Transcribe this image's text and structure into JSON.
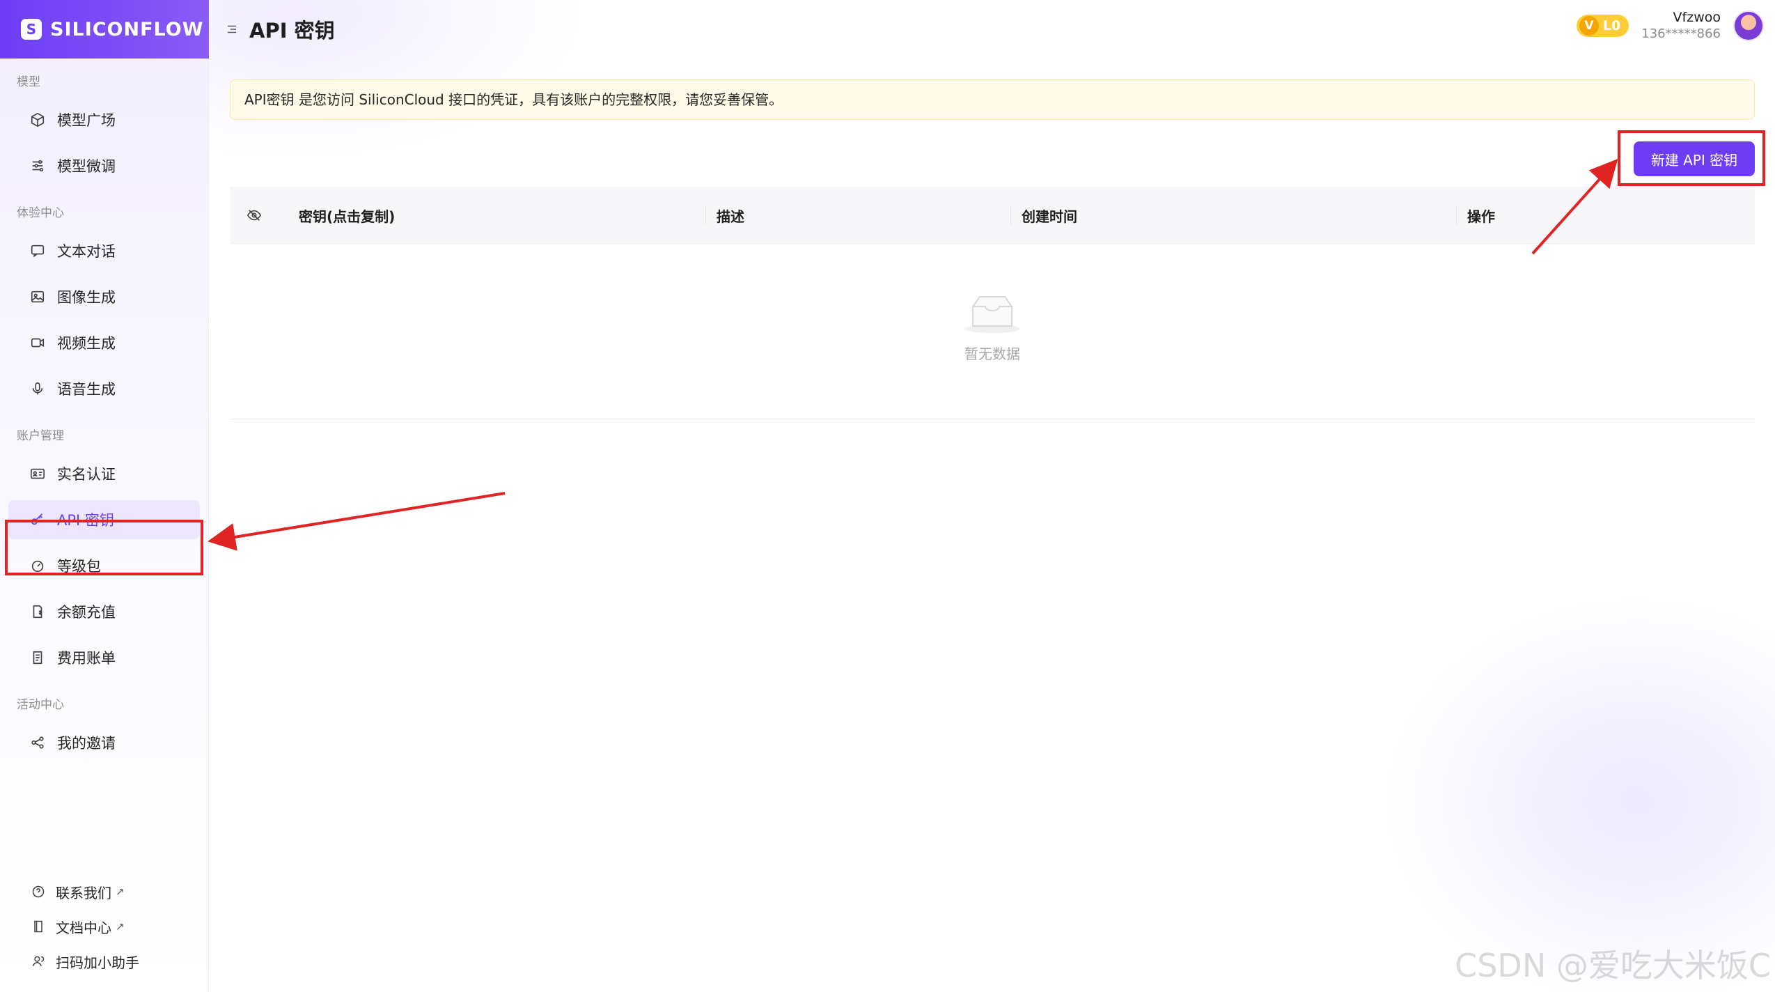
{
  "brand": {
    "name": "SILICONFLOW"
  },
  "sidebar": {
    "sections": [
      {
        "title": "模型",
        "items": [
          {
            "label": "模型广场",
            "icon": "cube-icon"
          },
          {
            "label": "模型微调",
            "icon": "sliders-icon"
          }
        ]
      },
      {
        "title": "体验中心",
        "items": [
          {
            "label": "文本对话",
            "icon": "chat-icon"
          },
          {
            "label": "图像生成",
            "icon": "image-icon"
          },
          {
            "label": "视频生成",
            "icon": "video-icon"
          },
          {
            "label": "语音生成",
            "icon": "microphone-icon"
          }
        ]
      },
      {
        "title": "账户管理",
        "items": [
          {
            "label": "实名认证",
            "icon": "id-card-icon"
          },
          {
            "label": "API 密钥",
            "icon": "key-icon",
            "active": true
          },
          {
            "label": "等级包",
            "icon": "gauge-icon"
          },
          {
            "label": "余额充值",
            "icon": "recharge-icon"
          },
          {
            "label": "费用账单",
            "icon": "bill-icon"
          }
        ]
      },
      {
        "title": "活动中心",
        "items": [
          {
            "label": "我的邀请",
            "icon": "share-icon"
          }
        ]
      }
    ],
    "footer": [
      {
        "label": "联系我们",
        "external": "↗",
        "icon": "help-circle-icon"
      },
      {
        "label": "文档中心",
        "external": "↗",
        "icon": "book-icon"
      },
      {
        "label": "扫码加小助手",
        "icon": "user-icon"
      }
    ]
  },
  "header": {
    "title": "API 密钥",
    "level_badge": {
      "v": "V",
      "level": "L0"
    },
    "user": {
      "name": "Vfzwoo",
      "phone": "136*****866"
    }
  },
  "notice": {
    "text": "API密钥 是您访问 SiliconCloud 接口的凭证，具有该账户的完整权限，请您妥善保管。"
  },
  "actions": {
    "new_key": "新建 API 密钥"
  },
  "table": {
    "columns": [
      "密钥(点击复制)",
      "描述",
      "创建时间",
      "操作"
    ],
    "empty_text": "暂无数据"
  },
  "watermark": "CSDN @爱吃大米饭C",
  "colors": {
    "primary": "#6d3df5",
    "annotation": "#e02424",
    "notice_bg": "#fffbe8"
  }
}
